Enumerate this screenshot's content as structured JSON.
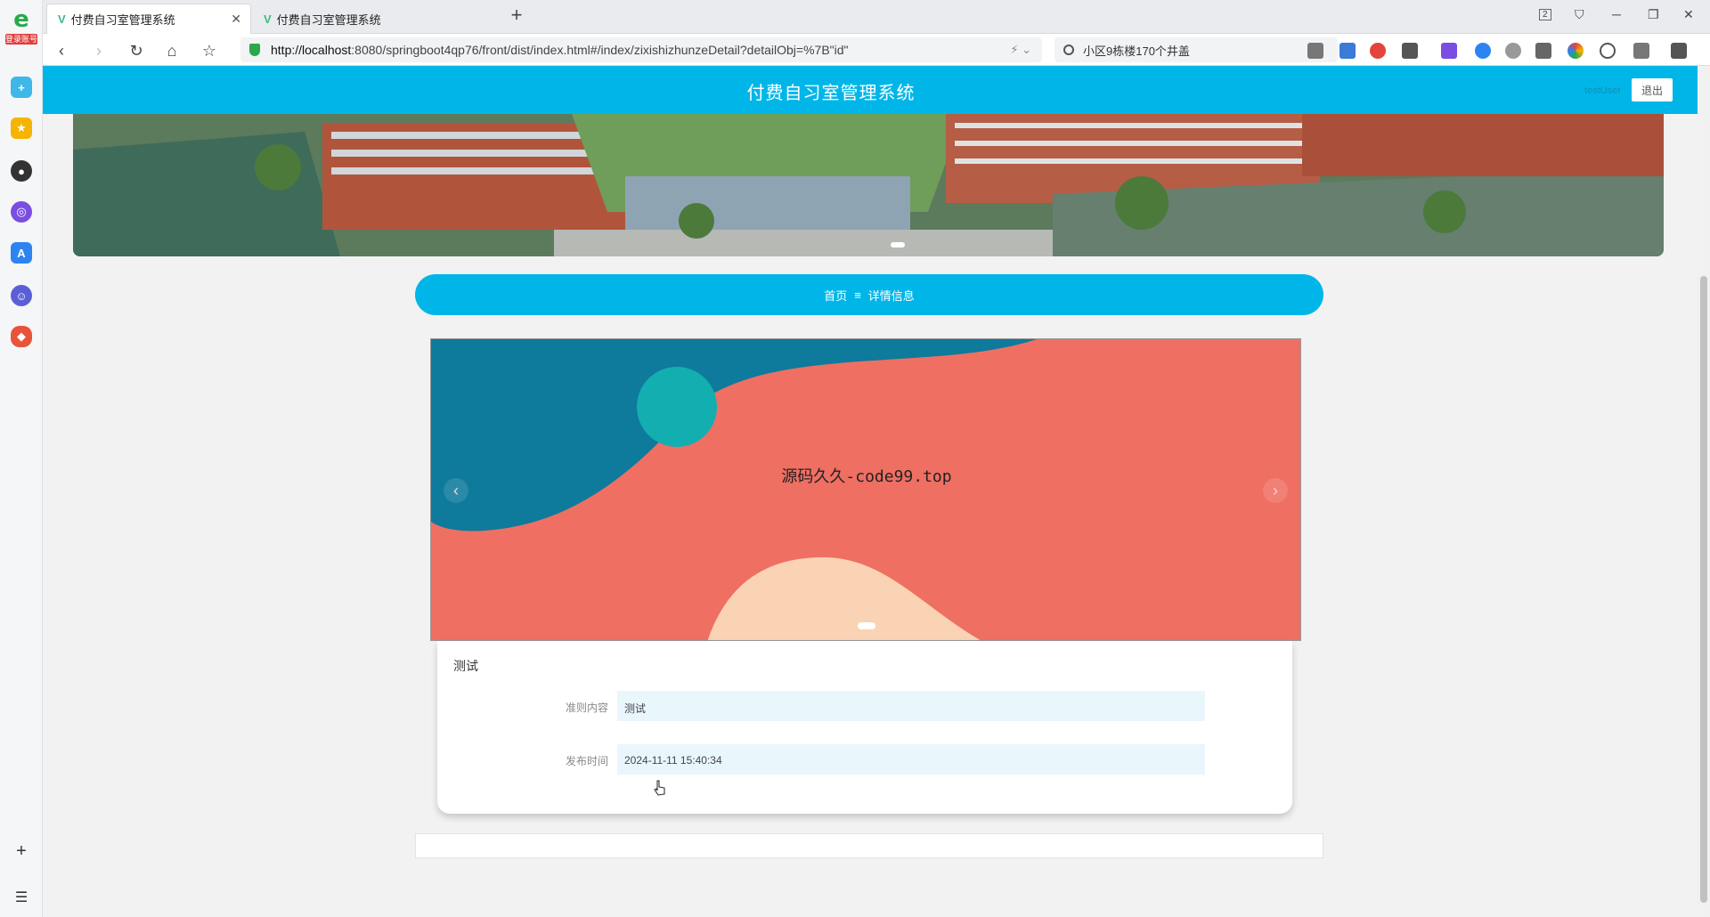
{
  "browser": {
    "sidebar_logo": "e",
    "sidebar_logo_tag": "登录账号",
    "tabs": [
      {
        "label": "付费自习室管理系统",
        "active": true
      },
      {
        "label": "付费自习室管理系统",
        "active": false
      }
    ],
    "tab_count_badge": "2",
    "url_host": "http://localhost",
    "url_rest": ":8080/springboot4qp76/front/dist/index.html#/index/zixishizhunzeDetail?detailObj=%7B\"id\"",
    "search_text": "小区9栋楼170个井盖"
  },
  "site": {
    "title": "付费自习室管理系统",
    "user": "testUser",
    "logout_label": "退出"
  },
  "breadcrumb": {
    "home": "首页",
    "separator": "≡",
    "current": "详情信息"
  },
  "carousel": {
    "caption": "源码久久-code99.top",
    "prev": "‹",
    "next": "›"
  },
  "detail": {
    "title": "测试",
    "fields": [
      {
        "label": "准则内容",
        "value": "测试"
      },
      {
        "label": "发布时间",
        "value": "2024-11-11 15:40:34"
      }
    ]
  },
  "colors": {
    "accent": "#00b6e8",
    "field_bg": "#e9f7fd",
    "carousel_coral": "#ef6f63",
    "carousel_blue": "#0e7a9c",
    "carousel_teal": "#13aeb0",
    "carousel_peach": "#f9d3b3"
  }
}
